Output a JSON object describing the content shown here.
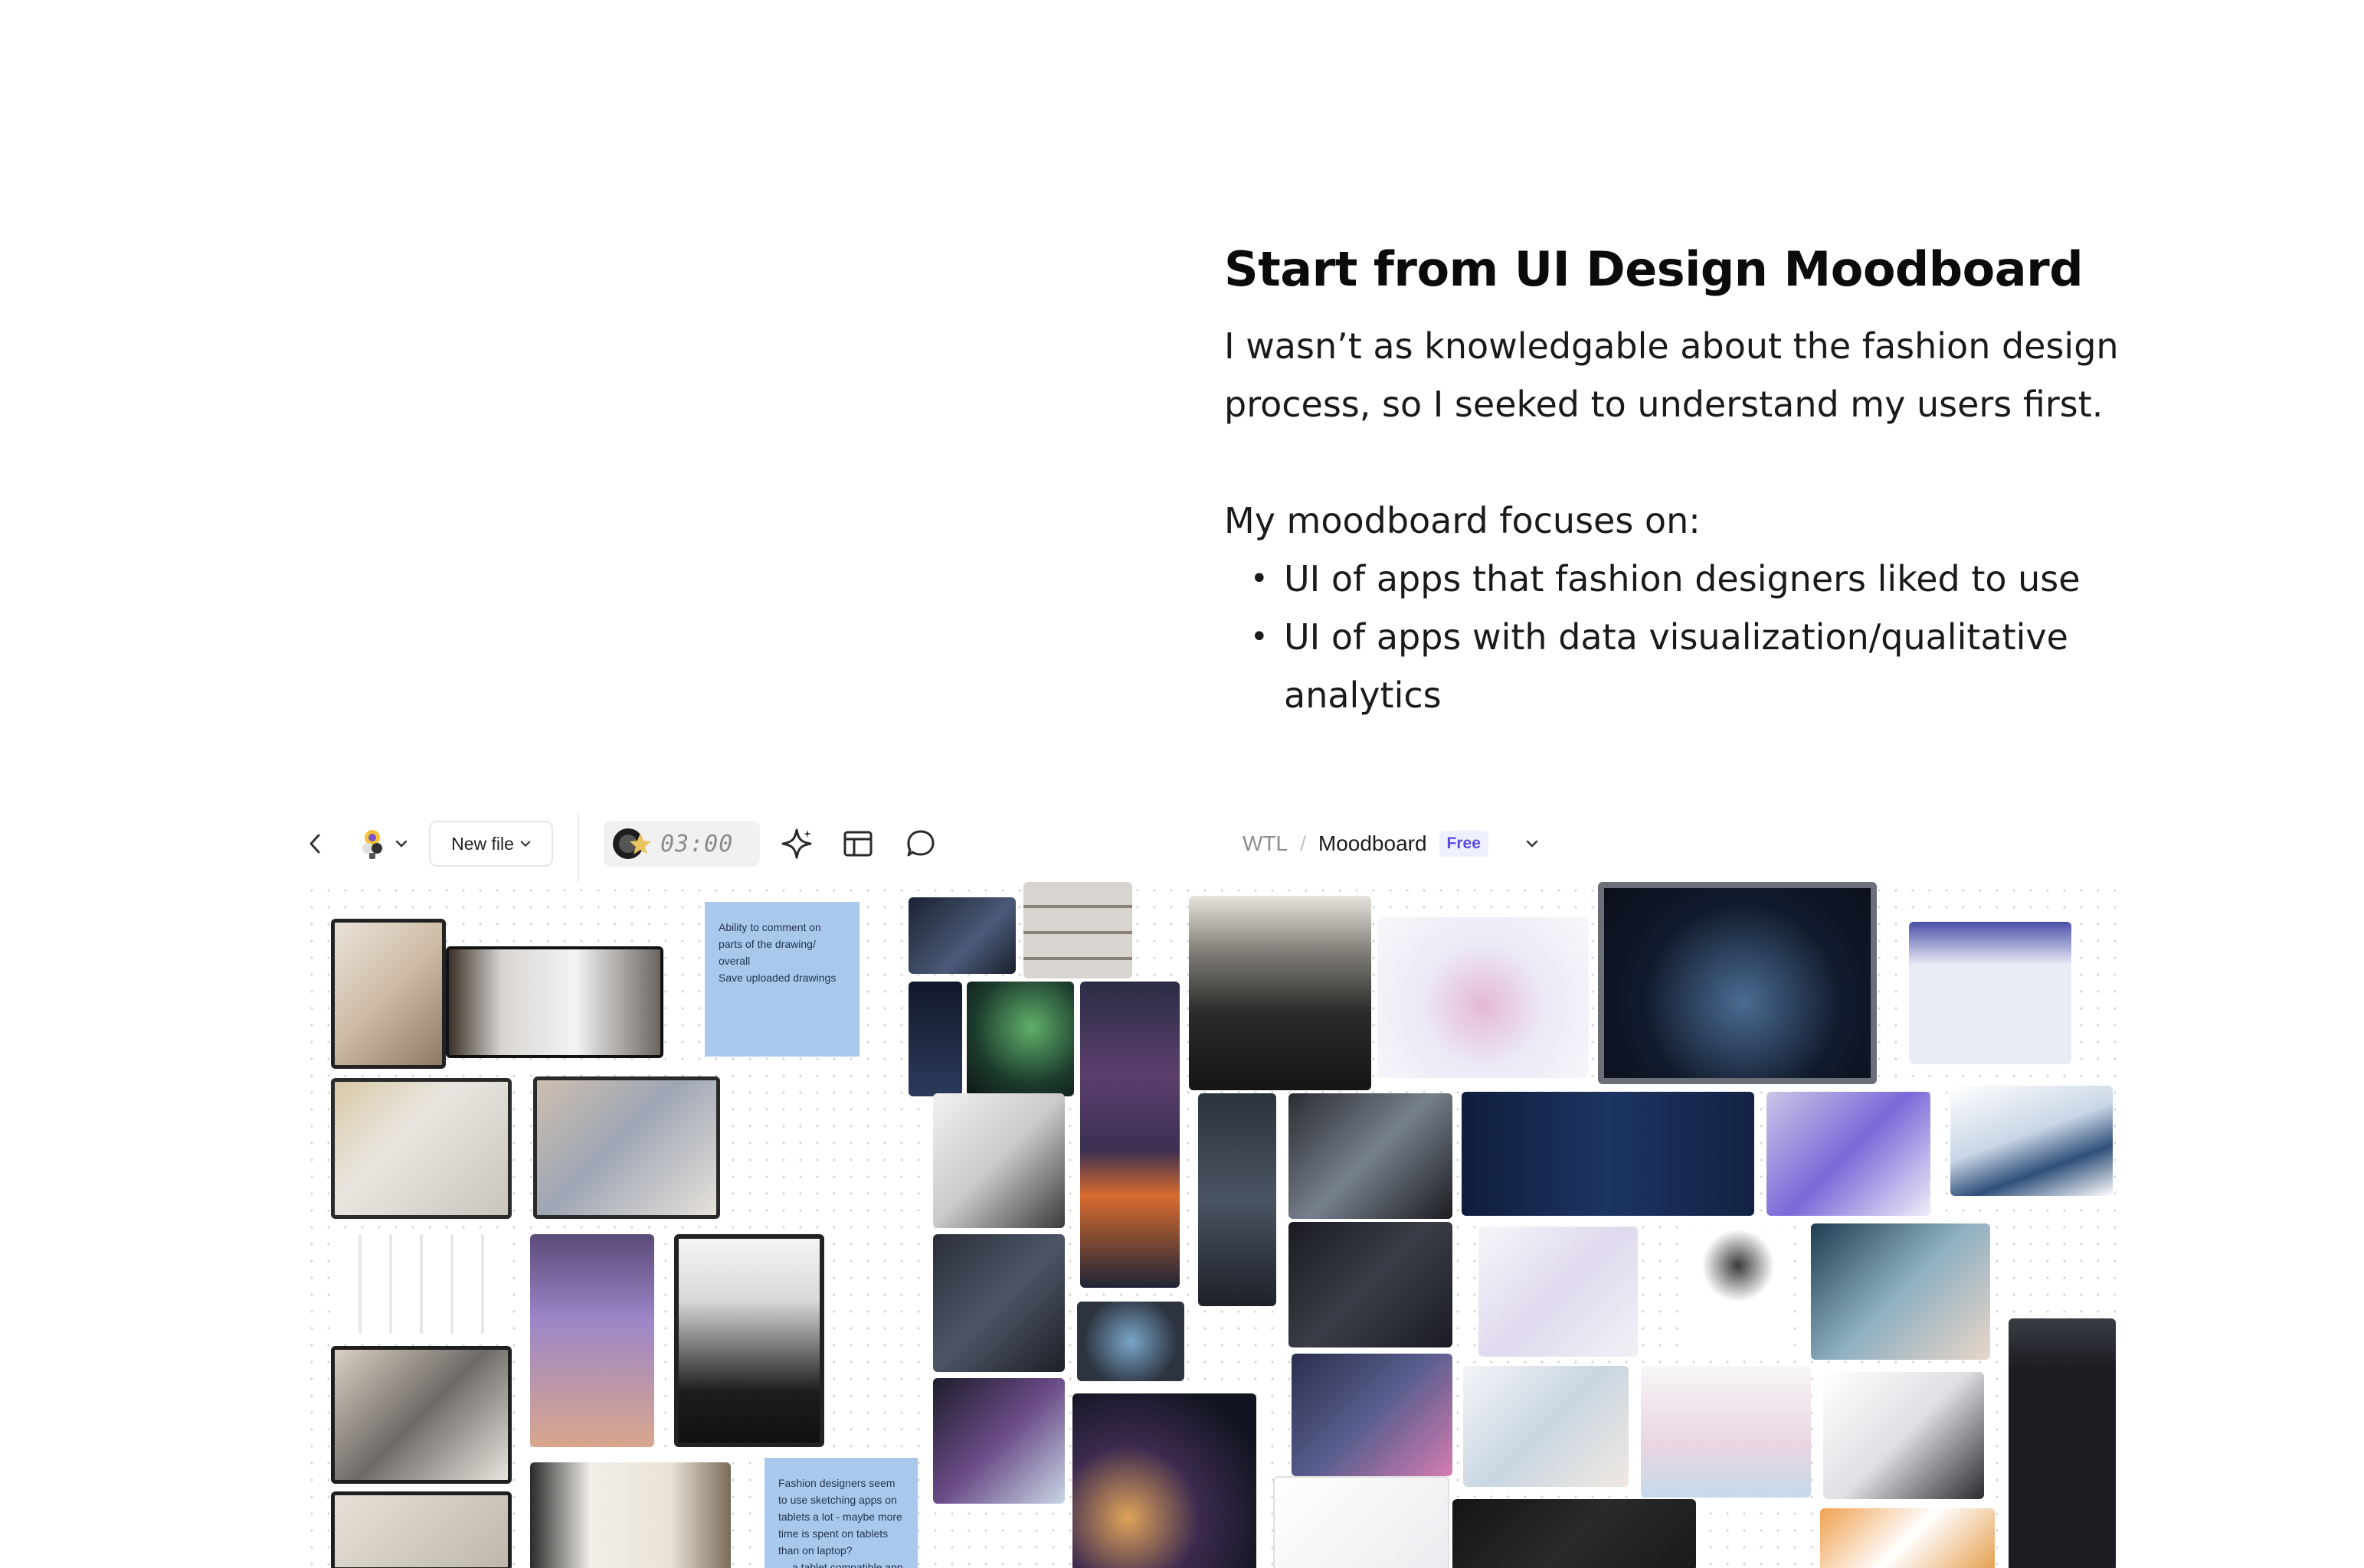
{
  "intro": {
    "heading": "Start from UI Design Moodboard",
    "paragraph_lines": [
      "I wasn’t as knowledgable about the fashion design",
      "process, so I seeked to understand my users first."
    ],
    "lead": "My moodboard focuses on:",
    "bullets": [
      {
        "line1": "UI of apps that fashion designers liked to use",
        "line2": ""
      },
      {
        "line1": "UI of apps with data visualization/qualitative",
        "line2": "analytics"
      }
    ],
    "bullet_glyph": "•"
  },
  "toolbar": {
    "back_icon": "chevron-left-icon",
    "app_icon": "figma-app-icon",
    "new_file_label": "New file",
    "timer_value": "03:00",
    "ai_icon": "sparkle-icon",
    "layout_icon": "layout-icon",
    "comment_icon": "comment-icon",
    "breadcrumb": {
      "team": "WTL",
      "separator": "/",
      "file": "Moodboard",
      "plan_badge": "Free"
    }
  },
  "stickies": [
    {
      "lines": [
        "Ability to comment on",
        "parts of the drawing/",
        "overall",
        "Save uploaded drawings"
      ]
    },
    {
      "lines": [
        "Fashion designers seem",
        "to use sketching apps on",
        "tablets a lot - maybe more",
        "time is spent on tablets",
        "than on laptop?",
        "→ a tablet compatible app"
      ]
    }
  ],
  "colors": {
    "sticky_blue": "#a9c9ec",
    "badge_text": "#5b4be0",
    "badge_bg": "#eef0ff"
  }
}
